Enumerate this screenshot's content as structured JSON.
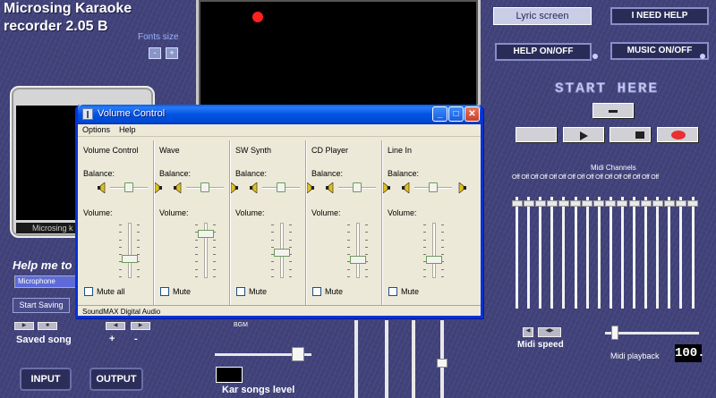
{
  "app": {
    "title_line1": "Microsing Karaoke",
    "title_line2": "recorder  2.05 B",
    "fonts_size": "Fonts size",
    "font_minus": "-",
    "font_plus": "+",
    "left_screen_label": "Microsing k",
    "help_me": "Help me to",
    "mic_value": "Microphone",
    "start_saving": "Start Saving",
    "saved_song": "Saved song",
    "plus": "+",
    "minus": "-",
    "input_button": "INPUT",
    "output_button": "OUTPUT",
    "lyric_screen": "Lyric screen",
    "need_help": "I NEED HELP",
    "help_onoff": "HELP ON/OFF",
    "music_onoff": "MUSIC ON/OFF",
    "start_here": "START HERE",
    "midi_channels": "Midi Channels",
    "off_label": "Off",
    "midi_speed": "Midi speed",
    "midi_playback": "Midi playback",
    "playback_value": "100.",
    "kar_songs_level": "Kar songs level",
    "bgm_label": "BGM"
  },
  "volume_control": {
    "title": "Volume Control",
    "menu": [
      "Options",
      "Help"
    ],
    "balance_label": "Balance:",
    "volume_label": "Volume:",
    "columns": [
      {
        "name": "Volume Control",
        "mute_label": "Mute all",
        "volume_level": 0.32,
        "muted": false
      },
      {
        "name": "Wave",
        "mute_label": "Mute",
        "volume_level": 0.85,
        "muted": false
      },
      {
        "name": "SW Synth",
        "mute_label": "Mute",
        "volume_level": 0.45,
        "muted": false
      },
      {
        "name": "CD Player",
        "mute_label": "Mute",
        "volume_level": 0.3,
        "muted": false
      },
      {
        "name": "Line In",
        "mute_label": "Mute",
        "volume_level": 0.3,
        "muted": false
      }
    ],
    "status": "SoundMAX Digital Audio"
  },
  "colors": {
    "background": "#41427a",
    "xp_title_blue": "#0054e3",
    "window_face": "#ece9d8",
    "record_red": "#e83030"
  }
}
